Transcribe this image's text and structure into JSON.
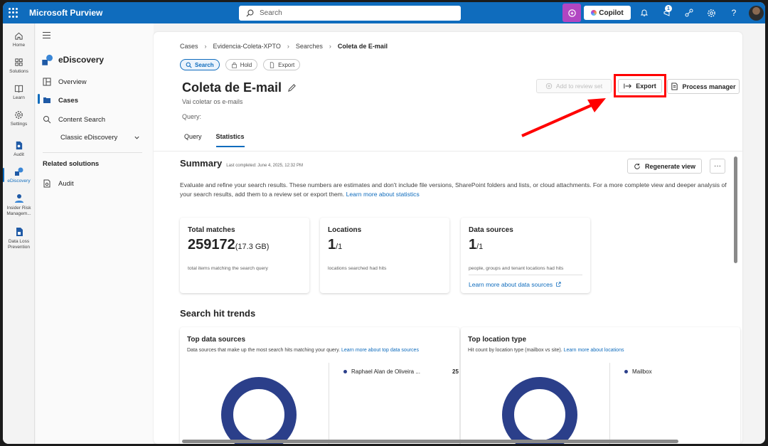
{
  "app": {
    "title": "Microsoft Purview"
  },
  "topbar": {
    "search_placeholder": "Search",
    "copilot_label": "Copilot",
    "notification_badge": "1"
  },
  "rail": {
    "items": [
      {
        "label": "Home",
        "icon": "home-icon"
      },
      {
        "label": "Solutions",
        "icon": "solutions-icon"
      },
      {
        "label": "Learn",
        "icon": "book-icon"
      },
      {
        "label": "Settings",
        "icon": "gear-icon"
      },
      {
        "label": "Audit",
        "icon": "audit-icon"
      },
      {
        "label": "eDiscovery",
        "icon": "ediscovery-icon"
      },
      {
        "label": "Insider Risk Managem...",
        "icon": "insider-risk-icon"
      },
      {
        "label": "Data Loss Prevention",
        "icon": "dlp-icon"
      }
    ]
  },
  "sidenav": {
    "header": "eDiscovery",
    "items": [
      {
        "label": "Overview"
      },
      {
        "label": "Cases"
      },
      {
        "label": "Content Search"
      },
      {
        "label": "Classic eDiscovery"
      }
    ],
    "related_title": "Related solutions",
    "related_items": [
      {
        "label": "Audit"
      }
    ]
  },
  "breadcrumb": [
    "Cases",
    "Evidencia-Coleta-XPTO",
    "Searches",
    "Coleta de E-mail"
  ],
  "pills": [
    "Search",
    "Hold",
    "Export"
  ],
  "page": {
    "title": "Coleta de E-mail",
    "subtitle": "Vai coletar os e-mails",
    "query_label": "Query:"
  },
  "actions": {
    "add_to_review": "Add to review set",
    "export": "Export",
    "process_manager": "Process manager"
  },
  "tabs": [
    "Query",
    "Statistics"
  ],
  "summary": {
    "title": "Summary",
    "last_completed": "Last completed: June 4, 2025, 12:32 PM",
    "regenerate": "Regenerate view",
    "more": "···",
    "description": "Evaluate and refine your search results. These numbers are estimates and don't include file versions, SharePoint folders and lists, or cloud attachments. For a more complete view and deeper analysis of your search results, add them to a review set or export them.",
    "description_link": "Learn more about statistics"
  },
  "cards": {
    "total": {
      "title": "Total matches",
      "value": "259172",
      "size": "(17.3 GB)",
      "desc": "total items matching the search query"
    },
    "locations": {
      "title": "Locations",
      "value": "1",
      "of": "/1",
      "desc": "locations searched had hits"
    },
    "sources": {
      "title": "Data sources",
      "value": "1",
      "of": "/1",
      "desc": "people, groups and tenant locations had hits",
      "link": "Learn more about data sources"
    }
  },
  "trends": {
    "title": "Search hit trends",
    "top_sources": {
      "title": "Top data sources",
      "desc": "Data sources that make up the most search hits matching your query.",
      "link": "Learn more about top data sources",
      "legend": "Raphael Alan de Oliveira ...",
      "legend_value": "25"
    },
    "top_location": {
      "title": "Top location type",
      "desc": "Hit count by location type (mailbox vs site).",
      "link": "Learn more about locations",
      "legend": "Mailbox"
    }
  },
  "colors": {
    "brand": "#0f6cbd",
    "highlight": "#ff0000",
    "donut": "#2b3f8a",
    "copilot": "#b146c2"
  }
}
